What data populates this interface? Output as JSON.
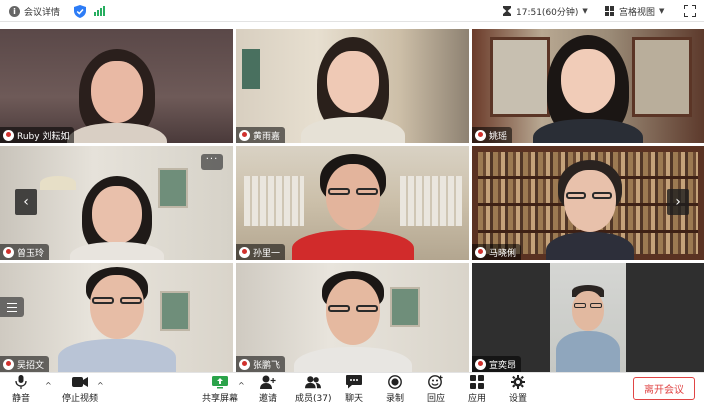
{
  "topbar": {
    "meeting_info_label": "会议详情",
    "time_label": "17:51(60分钟)",
    "view_label": "宫格视图"
  },
  "participants": [
    {
      "name": "Ruby 刘耘如"
    },
    {
      "name": "黄雨嘉"
    },
    {
      "name": "姚瑶"
    },
    {
      "name": "曾玉玲"
    },
    {
      "name": "孙里一"
    },
    {
      "name": "马晓俐"
    },
    {
      "name": "吴招文"
    },
    {
      "name": "张鹏飞"
    },
    {
      "name": "宣奕昂"
    }
  ],
  "tile_controls": {
    "more_label": "···",
    "prev_label": "‹",
    "next_label": "›"
  },
  "toolbar": {
    "mute": "静音",
    "stop_video": "停止视频",
    "share_screen": "共享屏幕",
    "invite": "邀请",
    "members": "成员(37)",
    "chat": "聊天",
    "record": "录制",
    "reactions": "回应",
    "apps": "应用",
    "settings": "设置",
    "leave": "离开会议"
  },
  "colors": {
    "accent_blue": "#2d7cf6",
    "signal_green": "#27ae60",
    "leave_red": "#e04545",
    "share_green": "#2aa34a",
    "muted_red": "#d0312d"
  },
  "icons": {
    "meeting_info": "info-icon",
    "security": "shield-icon",
    "network": "signal-icon",
    "time": "clock-icon",
    "view": "grid-view-icon",
    "fullscreen": "fullscreen-icon"
  }
}
